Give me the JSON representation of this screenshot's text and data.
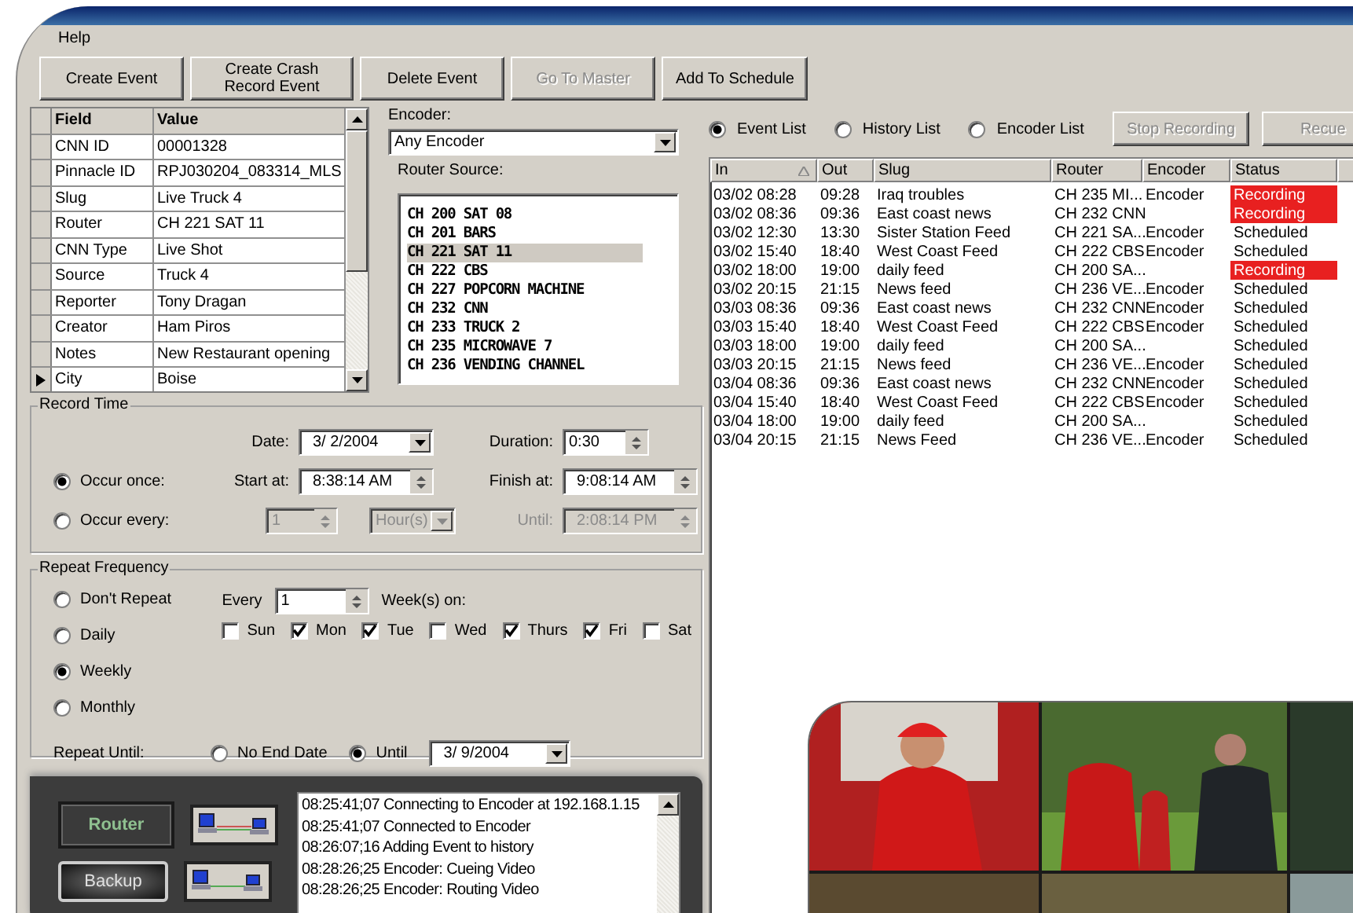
{
  "menu": [
    "Help"
  ],
  "toolbar": [
    {
      "label": "Create Event",
      "disabled": false
    },
    {
      "label": "Create Crash Record Event",
      "disabled": false
    },
    {
      "label": "Delete Event",
      "disabled": false
    },
    {
      "label": "Go To Master",
      "disabled": true
    },
    {
      "label": "Add To Schedule",
      "disabled": false
    }
  ],
  "properties": {
    "columns": [
      "Field",
      "Value"
    ],
    "rows": [
      {
        "field": "CNN ID",
        "value": "00001328",
        "current": false
      },
      {
        "field": "Pinnacle ID",
        "value": "RPJ030204_083314_MLS",
        "current": false
      },
      {
        "field": "Slug",
        "value": "Live Truck 4",
        "current": false
      },
      {
        "field": "Router",
        "value": "CH 221 SAT 11",
        "current": false
      },
      {
        "field": "CNN Type",
        "value": "Live Shot",
        "current": false
      },
      {
        "field": "Source",
        "value": "Truck 4",
        "current": false
      },
      {
        "field": "Reporter",
        "value": "Tony Dragan",
        "current": false
      },
      {
        "field": "Creator",
        "value": "Ham Piros",
        "current": false
      },
      {
        "field": "Notes",
        "value": "New Restaurant opening",
        "current": false
      },
      {
        "field": "City",
        "value": "Boise",
        "current": true
      }
    ]
  },
  "encoder": {
    "label": "Encoder:",
    "value": "Any Encoder"
  },
  "router_source": {
    "label": "Router Source:",
    "items": [
      {
        "text": "CH 200 SAT 08",
        "selected": false
      },
      {
        "text": "CH 201 BARS",
        "selected": false
      },
      {
        "text": "CH 221 SAT 11",
        "selected": true
      },
      {
        "text": "CH 222 CBS",
        "selected": false
      },
      {
        "text": "CH 227 POPCORN MACHINE",
        "selected": false
      },
      {
        "text": "CH 232 CNN",
        "selected": false
      },
      {
        "text": "CH 233 TRUCK 2",
        "selected": false
      },
      {
        "text": "CH 235 MICROWAVE 7",
        "selected": false
      },
      {
        "text": "CH 236 VENDING CHANNEL",
        "selected": false
      }
    ]
  },
  "record_time": {
    "title": "Record Time",
    "date_label": "Date:",
    "date": "3/ 2/2004",
    "duration_label": "Duration:",
    "duration": "0:30",
    "occur_once": {
      "label": "Occur once:",
      "selected": true
    },
    "start_label": "Start at:",
    "start": "8:38:14 AM",
    "finish_label": "Finish at:",
    "finish": "9:08:14 AM",
    "occur_every": {
      "label": "Occur every:",
      "selected": false,
      "disabled": true
    },
    "every_value": "1",
    "every_unit": "Hour(s)",
    "until_label": "Until:",
    "until": "2:08:14 PM"
  },
  "repeat": {
    "title": "Repeat Frequency",
    "options": [
      {
        "label": "Don't Repeat",
        "selected": false
      },
      {
        "label": "Daily",
        "selected": false
      },
      {
        "label": "Weekly",
        "selected": true
      },
      {
        "label": "Monthly",
        "selected": false
      }
    ],
    "every_label": "Every",
    "every": "1",
    "weeks_label": "Week(s) on:",
    "days": [
      {
        "label": "Sun",
        "checked": false
      },
      {
        "label": "Mon",
        "checked": true
      },
      {
        "label": "Tue",
        "checked": true
      },
      {
        "label": "Wed",
        "checked": false
      },
      {
        "label": "Thurs",
        "checked": true
      },
      {
        "label": "Fri",
        "checked": true
      },
      {
        "label": "Sat",
        "checked": false
      }
    ],
    "until_label": "Repeat Until:",
    "until_options": [
      {
        "label": "No End Date",
        "selected": false
      },
      {
        "label": "Until",
        "selected": true
      }
    ],
    "until_date": "3/ 9/2004"
  },
  "list_modes": [
    {
      "label": "Event List",
      "selected": true
    },
    {
      "label": "History List",
      "selected": false
    },
    {
      "label": "Encoder List",
      "selected": false
    }
  ],
  "list_buttons": [
    {
      "label": "Stop Recording",
      "disabled": true
    },
    {
      "label": "Recue",
      "disabled": true
    }
  ],
  "events": {
    "columns": [
      "In",
      "Out",
      "Slug",
      "Router",
      "Encoder",
      "Status"
    ],
    "rows": [
      {
        "in": "03/02  08:28",
        "out": "09:28",
        "slug": "Iraq troubles",
        "router": "CH 235 MI...",
        "encoder": "Encoder",
        "status": "Recording",
        "recording": true
      },
      {
        "in": "03/02  08:36",
        "out": "09:36",
        "slug": "East coast news",
        "router": "CH 232 CNN",
        "encoder": "",
        "status": "Recording",
        "recording": true
      },
      {
        "in": "03/02  12:30",
        "out": "13:30",
        "slug": "Sister Station Feed",
        "router": "CH 221 SA...",
        "encoder": "Encoder",
        "status": "Scheduled",
        "recording": false
      },
      {
        "in": "03/02  15:40",
        "out": "18:40",
        "slug": "West Coast Feed",
        "router": "CH 222 CBS",
        "encoder": "Encoder",
        "status": "Scheduled",
        "recording": false
      },
      {
        "in": "03/02  18:00",
        "out": "19:00",
        "slug": "daily feed",
        "router": "CH 200 SA...",
        "encoder": "",
        "status": "Recording",
        "recording": true
      },
      {
        "in": "03/02  20:15",
        "out": "21:15",
        "slug": "News feed",
        "router": "CH 236 VE...",
        "encoder": "Encoder",
        "status": "Scheduled",
        "recording": false
      },
      {
        "in": "03/03  08:36",
        "out": "09:36",
        "slug": "East coast news",
        "router": "CH 232 CNN",
        "encoder": "Encoder",
        "status": "Scheduled",
        "recording": false
      },
      {
        "in": "03/03  15:40",
        "out": "18:40",
        "slug": "West Coast Feed",
        "router": "CH 222 CBS",
        "encoder": "Encoder",
        "status": "Scheduled",
        "recording": false
      },
      {
        "in": "03/03  18:00",
        "out": "19:00",
        "slug": "daily feed",
        "router": "CH 200 SA...",
        "encoder": "",
        "status": "Scheduled",
        "recording": false
      },
      {
        "in": "03/03  20:15",
        "out": "21:15",
        "slug": "News feed",
        "router": "CH 236 VE...",
        "encoder": "Encoder",
        "status": "Scheduled",
        "recording": false
      },
      {
        "in": "03/04  08:36",
        "out": "09:36",
        "slug": "East coast news",
        "router": "CH 232 CNN",
        "encoder": "Encoder",
        "status": "Scheduled",
        "recording": false
      },
      {
        "in": "03/04  15:40",
        "out": "18:40",
        "slug": "West Coast Feed",
        "router": "CH 222 CBS",
        "encoder": "Encoder",
        "status": "Scheduled",
        "recording": false
      },
      {
        "in": "03/04  18:00",
        "out": "19:00",
        "slug": "daily feed",
        "router": "CH 200 SA...",
        "encoder": "",
        "status": "Scheduled",
        "recording": false
      },
      {
        "in": "03/04  20:15",
        "out": "21:15",
        "slug": "News Feed",
        "router": "CH 236 VE...",
        "encoder": "Encoder",
        "status": "Scheduled",
        "recording": false
      }
    ]
  },
  "connections": {
    "router": "Router",
    "backup": "Backup"
  },
  "log": [
    "08:25:41;07 Connecting to Encoder at 192.168.1.15",
    "08:25:41;07 Connected to Encoder",
    "08:26:07;16 Adding Event to history",
    "08:28:26;25 Encoder: Cueing Video",
    "08:28:26;25 Encoder: Routing Video"
  ],
  "preview": {
    "kind": "picture"
  }
}
